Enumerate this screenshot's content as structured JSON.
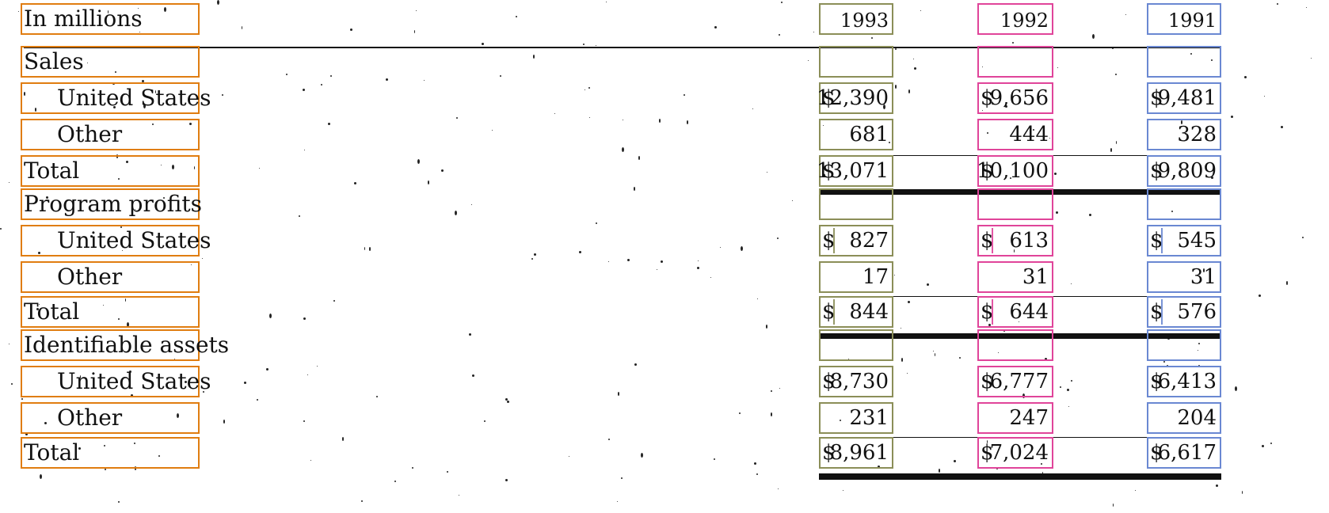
{
  "table": {
    "years": [
      "1993",
      "1992",
      "1991"
    ],
    "rows": [
      {
        "label": "In millions",
        "indent": 0,
        "values": [
          "1993",
          "1992",
          "1991"
        ],
        "currency": [
          false,
          false,
          false
        ]
      },
      {
        "label": "Sales",
        "indent": 0,
        "values": [
          "",
          "",
          ""
        ],
        "currency": [
          false,
          false,
          false
        ]
      },
      {
        "label": "United States",
        "indent": 1,
        "values": [
          "12,390",
          "9,656",
          "9,481"
        ],
        "currency": [
          true,
          true,
          true
        ]
      },
      {
        "label": "Other",
        "indent": 1,
        "values": [
          "681",
          "444",
          "328"
        ],
        "currency": [
          false,
          false,
          false
        ]
      },
      {
        "label": "Total",
        "indent": 0,
        "values": [
          "13,071",
          "10,100",
          "9,809"
        ],
        "currency": [
          true,
          true,
          true
        ]
      },
      {
        "label": "Program profits",
        "indent": 0,
        "values": [
          "",
          "",
          ""
        ],
        "currency": [
          false,
          false,
          false
        ]
      },
      {
        "label": "United States",
        "indent": 1,
        "values": [
          "827",
          "613",
          "545"
        ],
        "currency": [
          true,
          true,
          true
        ]
      },
      {
        "label": "Other",
        "indent": 1,
        "values": [
          "17",
          "31",
          "31"
        ],
        "currency": [
          false,
          false,
          false
        ]
      },
      {
        "label": "Total",
        "indent": 0,
        "values": [
          "844",
          "644",
          "576"
        ],
        "currency": [
          true,
          true,
          true
        ]
      },
      {
        "label": "Identifiable assets",
        "indent": 0,
        "values": [
          "",
          "",
          ""
        ],
        "currency": [
          false,
          false,
          false
        ]
      },
      {
        "label": "United States",
        "indent": 1,
        "values": [
          "8,730",
          "6,777",
          "6,413"
        ],
        "currency": [
          true,
          true,
          true
        ]
      },
      {
        "label": "Other",
        "indent": 1,
        "values": [
          "231",
          "247",
          "204"
        ],
        "currency": [
          false,
          false,
          false
        ]
      },
      {
        "label": "Total",
        "indent": 0,
        "values": [
          "8,961",
          "7,024",
          "6,617"
        ],
        "currency": [
          true,
          true,
          true
        ]
      }
    ],
    "currency_symbol": "$"
  },
  "colors": {
    "label_box": "#e07d10",
    "col1_box": "#8b8e58",
    "col2_box": "#e0449a",
    "col3_box": "#6a88d2"
  }
}
